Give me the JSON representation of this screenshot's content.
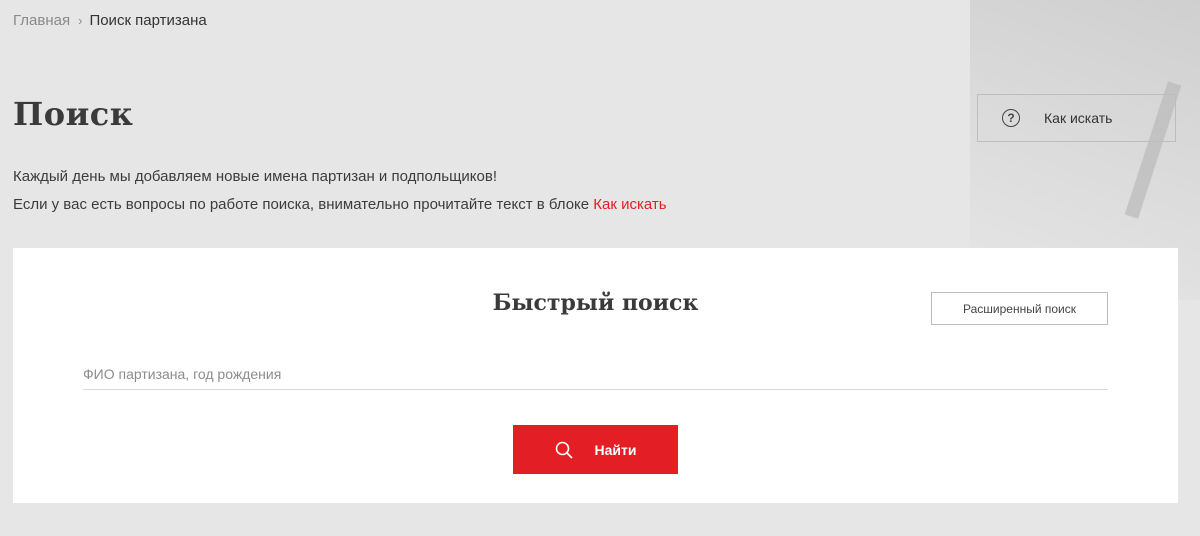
{
  "breadcrumb": {
    "home": "Главная",
    "separator": "›",
    "current": "Поиск партизана"
  },
  "header": {
    "title": "Поиск",
    "how_to_search_label": "Как искать",
    "how_to_search_icon": "question-circle-icon"
  },
  "intro": {
    "line1": "Каждый день мы добавляем новые имена партизан и подпольщиков!",
    "line2_prefix": "Если у вас есть вопросы по работе поиска, внимательно прочитайте текст в блоке",
    "line2_link": "Как искать"
  },
  "quick_search": {
    "title": "Быстрый поиск",
    "advanced_label": "Расширенный поиск",
    "input_value": "",
    "input_placeholder": "ФИО партизана, год рождения",
    "submit_label": "Найти",
    "submit_icon": "search-icon"
  },
  "colors": {
    "accent": "#e31e24",
    "background": "#e6e6e6",
    "panel": "#ffffff",
    "text": "#333333"
  }
}
